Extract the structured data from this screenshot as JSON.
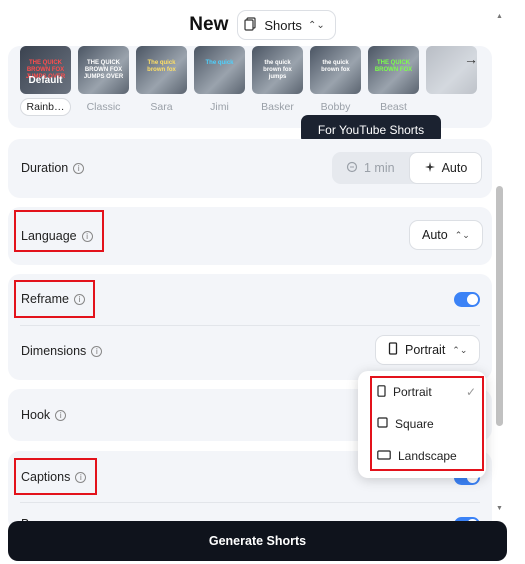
{
  "header": {
    "title": "New",
    "type_value": "Shorts"
  },
  "styles": {
    "items": [
      {
        "label": "Rainb…",
        "caption": "THE QUICK BROWN FOX JUMPS OVER",
        "selected": true,
        "badge": "Default"
      },
      {
        "label": "Classic",
        "caption": "THE QUICK BROWN FOX JUMPS OVER"
      },
      {
        "label": "Sara",
        "caption": "The quick brown fox"
      },
      {
        "label": "Jimi",
        "caption": "The quick"
      },
      {
        "label": "Basker",
        "caption": "the quick brown fox jumps"
      },
      {
        "label": "Bobby",
        "caption": "the quick brown fox"
      },
      {
        "label": "Beast",
        "caption": "THE QUICK BROWN FOX"
      },
      {
        "label": "",
        "caption": ""
      }
    ]
  },
  "tooltip": "For YouTube Shorts",
  "duration": {
    "label": "Duration",
    "options": [
      "1 min",
      "Auto"
    ],
    "selected": "Auto"
  },
  "language": {
    "label": "Language",
    "value": "Auto"
  },
  "reframe": {
    "label": "Reframe",
    "enabled": true
  },
  "dimensions": {
    "label": "Dimensions",
    "value": "Portrait"
  },
  "hook": {
    "label": "Hook"
  },
  "captions": {
    "label": "Captions",
    "enabled": true
  },
  "partial_row": {
    "label": "B…"
  },
  "dimension_menu": {
    "items": [
      {
        "label": "Portrait",
        "icon": "portrait-icon",
        "checked": true
      },
      {
        "label": "Square",
        "icon": "square-icon",
        "checked": false
      },
      {
        "label": "Landscape",
        "icon": "landscape-icon",
        "checked": false
      }
    ]
  },
  "generate_button": "Generate Shorts",
  "colors": {
    "accent": "#3b82f6",
    "highlight": "#e3121b",
    "button": "#0f131c"
  }
}
